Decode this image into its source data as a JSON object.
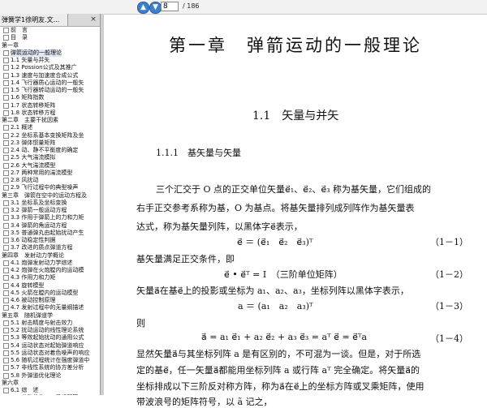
{
  "toolbar": {
    "page_number": "8",
    "page_total": "/ 186"
  },
  "tab": {
    "title": "弹簧学1徐明友.文...",
    "close": "×"
  },
  "icons": {
    "up": "▲",
    "down": "▼"
  },
  "toc": [
    {
      "text": "前　言",
      "box": true
    },
    {
      "text": "目　录",
      "box": true
    },
    {
      "text": "第一章　",
      "box": false
    },
    {
      "text": "1.1 矢量与并矢",
      "box": true
    },
    {
      "text": "1.2 Possion公式及其推广",
      "box": true
    },
    {
      "text": "1.3 速度与加速度合成公式",
      "box": true
    },
    {
      "text": "1.4 飞行器质心运动的一般矢",
      "box": true
    },
    {
      "text": "1.5 飞行器转动运动的一般矢",
      "box": true
    },
    {
      "text": "1.6 矩阵指数",
      "box": true
    },
    {
      "text": "1.7 状态转移矩阵",
      "box": true
    },
    {
      "text": "1.8 状态转移方程",
      "box": true
    },
    {
      "text": "第二章　主要干扰因素",
      "box": false
    },
    {
      "text": "2.1 概述",
      "box": true
    },
    {
      "text": "2.2 坐标系基本变换矩阵及坐",
      "box": true
    },
    {
      "text": "2.3 弹体惯量矩阵",
      "box": true
    },
    {
      "text": "2.4 动、静不平衡度的确定",
      "box": true
    },
    {
      "text": "2.5 大气湍流模拟",
      "box": true
    },
    {
      "text": "2.6 大气湍流模型",
      "box": true
    },
    {
      "text": "2.7 两种常用的湍流模型",
      "box": true
    },
    {
      "text": "2.8 风扰动",
      "box": true
    },
    {
      "text": "2.9 飞行过程中的典型噪声",
      "box": true
    },
    {
      "text": "第三章　弹箭在空中的运动方程及",
      "box": false
    },
    {
      "text": "3.1 坐标系及坐标变换",
      "box": true
    },
    {
      "text": "3.2 弹箭一般运动方程",
      "box": true
    },
    {
      "text": "3.3 作用于弹箭上的力和力矩",
      "box": true
    },
    {
      "text": "3.4 弹箭的角运动方程",
      "box": true
    },
    {
      "text": "3.5 普通弹丸由起始扰动产生",
      "box": true
    },
    {
      "text": "3.6 动稳定性判据",
      "box": true
    },
    {
      "text": "3.7 改进的质点弹道方程",
      "box": true
    },
    {
      "text": "第四章　发射动力学概论",
      "box": false
    },
    {
      "text": "4.1 炮弹发射动力学综述",
      "box": true
    },
    {
      "text": "4.2 炮弹在火炮膛内的运动模",
      "box": true
    },
    {
      "text": "4.3 作用力和力矩",
      "box": true
    },
    {
      "text": "4.4 旋转模型",
      "box": true
    },
    {
      "text": "4.5 火箭在膛内的运动模型",
      "box": true
    },
    {
      "text": "4.6 被动控制原理",
      "box": true
    },
    {
      "text": "4.7 发射过程中的无量纲描述",
      "box": true
    },
    {
      "text": "第五章　随机弹道学",
      "box": false
    },
    {
      "text": "5.1 射击精度与射击效力",
      "box": true
    },
    {
      "text": "5.2 扰动运动的线性理论系统",
      "box": true
    },
    {
      "text": "5.3 等效起始扰动的通用公式",
      "box": true
    },
    {
      "text": "5.4 运动状态对起始弹道响应",
      "box": true
    },
    {
      "text": "5.5 运动状态对着色噪声的响应",
      "box": true
    },
    {
      "text": "5.6 随机过程统计在强度弹道中",
      "box": true
    },
    {
      "text": "5.7 非线性系统的协方差分析",
      "box": true
    },
    {
      "text": "5.8 外弹道优化理论",
      "box": true
    },
    {
      "text": "第六章　",
      "box": false
    },
    {
      "text": "6.1 综　述",
      "box": true
    },
    {
      "text": "6.2 参数优化——反组双等",
      "box": true
    }
  ],
  "toc_selected": "弹箭运动的一般理论",
  "doc": {
    "chapter_title": "第一章　弹箭运动的一般理论",
    "section_title": "1.1　矢量与并矢",
    "subsection_title": "1.1.1　基矢量与矢量",
    "para1_line1": "三个汇交于 O 点的正交单位矢量e⃗₁、e⃗₂、e⃗₃ 称为基矢量，它们组成的",
    "para1_line2": "右手正交参考系称为基，O 为基点。将基矢量排列成列阵作为基矢量表",
    "para1_line3": "达式，称为基矢量列阵，以黑体字e⃗表示，",
    "eq1": "e⃗ ＝ (e⃗₁　e⃗₂　e⃗₃)ᵀ",
    "eq1_num": "（1－1）",
    "para2": "基矢量满足正交条件，即",
    "eq2": "e⃗ • e⃗ᵀ = I　（三阶单位矩阵）",
    "eq2_num": "（1－2）",
    "para3": "矢量a⃗在基e⃗上的投影或坐标为 a₁、a₂、a₃，坐标列阵以黑体字表示，",
    "eq3": "a ＝ (a₁　a₂　a₃)ᵀ",
    "eq3_num": "（1－3）",
    "para4": "则",
    "eq4": "a⃗ = a₁ e⃗₁ + a₂ e⃗₂ + a₃ e⃗₃ = aᵀ e⃗ = e⃗ᵀa",
    "eq4_num": "（1－4）",
    "para5_line1": "显然矢量a⃗与其坐标列阵 a 是有区别的，不可混为一谈。但是，对于所选",
    "para5_line2": "定的基e⃗，任一矢量a⃗都能用坐标列阵 a 或行阵 aᵀ 完全确定。将矢量a⃗的",
    "para5_line3": "坐标排成以下三阶反对称方阵，称为a⃗在e⃗上的坐标方阵或叉乘矩阵，使用",
    "para5_line4": "带波浪号的矩阵符号，以 ã 记之，"
  }
}
